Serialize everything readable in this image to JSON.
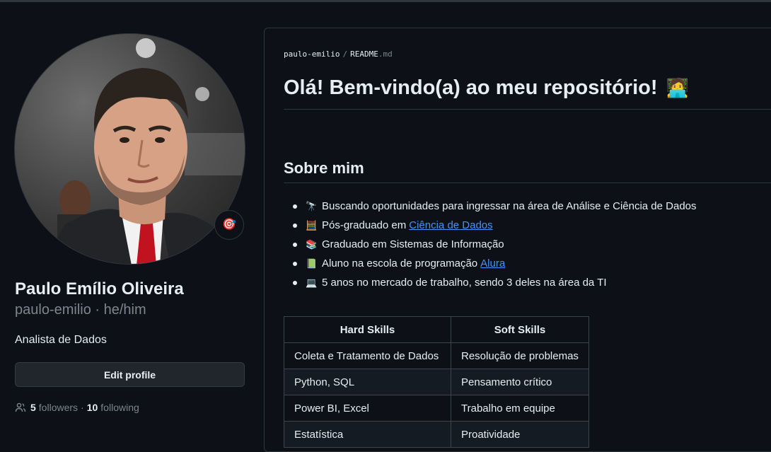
{
  "profile": {
    "avatar_alt": "Paulo Emílio Oliveira",
    "status_icon": "target-emoji",
    "name": "Paulo Emílio Oliveira",
    "login_line": "paulo-emilio · he/him",
    "bio": "Analista de Dados",
    "edit_button_label": "Edit profile",
    "followers_count": "5",
    "followers_label": "followers",
    "separator": "·",
    "following_count": "10",
    "following_label": "following"
  },
  "readme": {
    "path_user": "paulo-emilio",
    "path_separator": "/",
    "path_file": "README",
    "path_ext": ".md",
    "title": "Olá! Bem-vindo(a) ao meu repositório!",
    "title_emoji": "🧑‍💻",
    "about_heading": "Sobre mim",
    "about_items": [
      {
        "emoji": "🔭",
        "text": "Buscando oportunidades para ingressar na área de Análise e Ciência de Dados",
        "link": ""
      },
      {
        "emoji": "🧮",
        "text": "Pós-graduado em",
        "link": "Ciência de Dados"
      },
      {
        "emoji": "📚",
        "text": "Graduado em Sistemas de Informação",
        "link": ""
      },
      {
        "emoji": "📗",
        "text": "Aluno na escola de programação",
        "link": "Alura"
      },
      {
        "emoji": "💻",
        "text": "5 anos no mercado de trabalho, sendo 3 deles na área da TI",
        "link": ""
      }
    ],
    "skills_table": {
      "headers": [
        "Hard Skills",
        "Soft Skills"
      ],
      "rows": [
        [
          "Coleta e Tratamento de Dados",
          "Resolução de problemas"
        ],
        [
          "Python, SQL",
          "Pensamento crítico"
        ],
        [
          "Power BI, Excel",
          "Trabalho em equipe"
        ],
        [
          "Estatística",
          "Proatividade"
        ]
      ]
    }
  },
  "colors": {
    "background": "#0d1117",
    "border": "#30363d",
    "text": "#e6edf3",
    "muted": "#7d8590",
    "link": "#4493f8",
    "button_bg": "#21262d"
  }
}
